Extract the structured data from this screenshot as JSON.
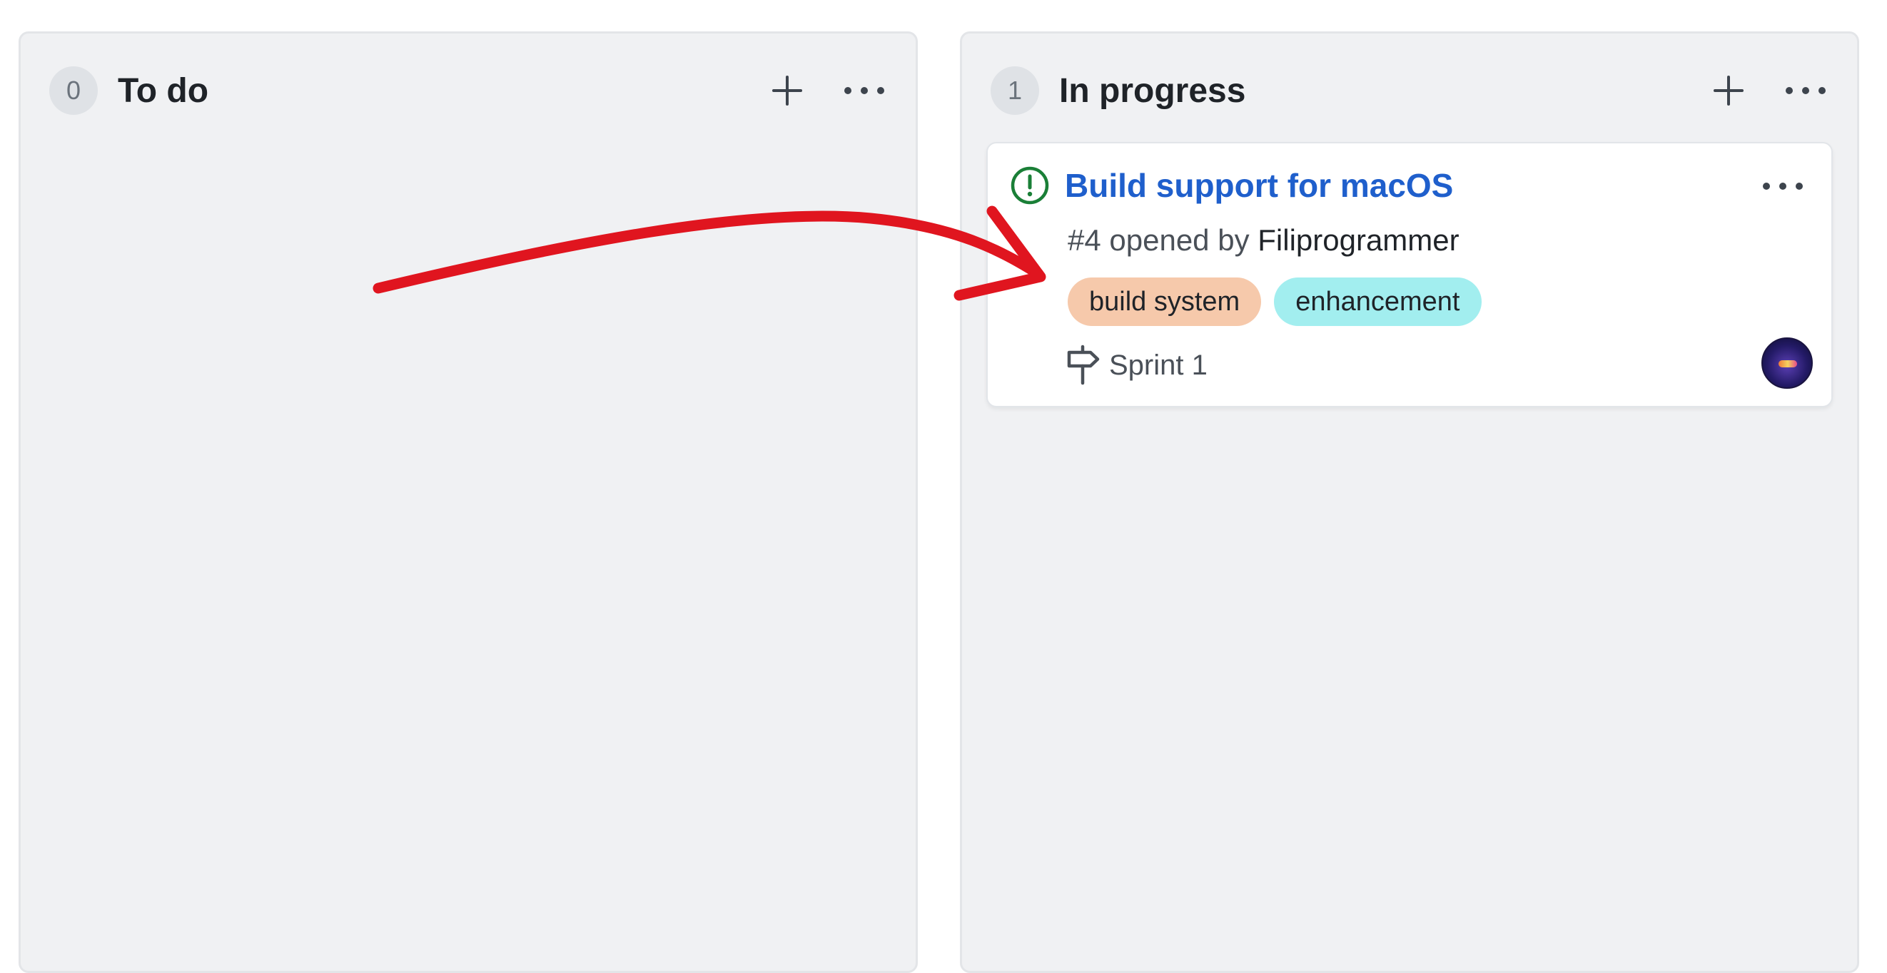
{
  "columns": [
    {
      "count": "0",
      "title": "To do",
      "cards": []
    },
    {
      "count": "1",
      "title": "In progress",
      "cards": [
        {
          "title": "Build support for macOS",
          "number": "#4",
          "opened_by_text": "opened by",
          "author": "Filiprogrammer",
          "labels": [
            {
              "name": "build system",
              "color": "#f6c9ab"
            },
            {
              "name": "enhancement",
              "color": "#a2eeef"
            }
          ],
          "milestone": "Sprint 1"
        }
      ]
    }
  ],
  "colors": {
    "issue_open": "#1a7f37",
    "title_link": "#1f5fcc",
    "annotation_arrow": "#e0151f"
  },
  "icons": {
    "add": "plus-icon",
    "menu": "kebab-horizontal-icon",
    "issue": "issue-opened-icon",
    "milestone": "milestone-icon",
    "annotation": "red-arrow-annotation"
  }
}
